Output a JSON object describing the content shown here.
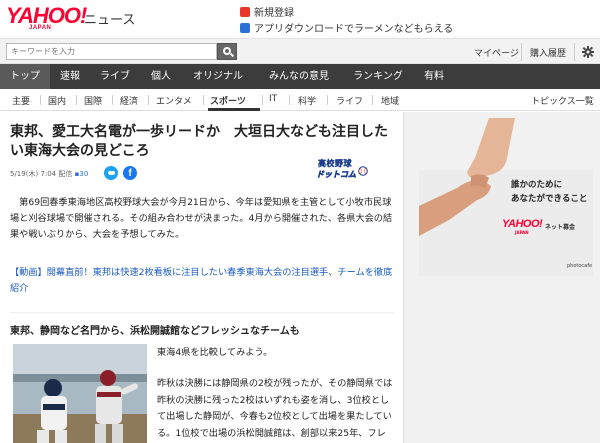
{
  "header": {
    "logo_text": "YAHOO!",
    "logo_sub": "JAPAN",
    "service_name": "ニュース",
    "promo_signup": "新規登録",
    "promo_app": "アプリダウンロードでラーメンなどもらえる"
  },
  "search": {
    "placeholder": "キーワードを入力"
  },
  "account": {
    "mypage": "マイページ",
    "premium": "購入履歴"
  },
  "main_nav": [
    {
      "label": "トップ",
      "active": true
    },
    {
      "label": "速報",
      "active": false
    },
    {
      "label": "ライブ",
      "active": false
    },
    {
      "label": "個人",
      "active": false
    },
    {
      "label": "オリジナル",
      "active": false
    },
    {
      "label": "みんなの意見",
      "active": false
    },
    {
      "label": "ランキング",
      "active": false
    },
    {
      "label": "有料",
      "active": false
    }
  ],
  "sub_nav": [
    {
      "label": "主要",
      "active": false
    },
    {
      "label": "国内",
      "active": false
    },
    {
      "label": "国際",
      "active": false
    },
    {
      "label": "経済",
      "active": false
    },
    {
      "label": "エンタメ",
      "active": false
    },
    {
      "label": "スポーツ",
      "active": true
    },
    {
      "label": "IT",
      "active": false
    },
    {
      "label": "科学",
      "active": false
    },
    {
      "label": "ライフ",
      "active": false
    },
    {
      "label": "地域",
      "active": false
    }
  ],
  "topics_link": "トピックス一覧",
  "article": {
    "title": "東邦、愛工大名電が一歩リードか　大垣日大なども注目したい東海大会の見どころ",
    "date": "5/19(木) 7:04",
    "delivery": "配信",
    "comment_count": "30",
    "media_line1": "高校野球",
    "media_line2": "ドットコム",
    "lead": "　第69回春季東海地区高校野球大会が今月21日から、今年は愛知県を主管として小牧市民球場と刈谷球場で開催される。その組み合わせが決まった。4月から開催された、各県大会の結果や戦いぶりから、大会を予想してみた。",
    "video_link": "【動画】開幕直前！東邦は快速2枚看板に注目したい春季東海大会の注目選手、チームを徹底紹介",
    "subheading": "東邦、静岡など名門から、浜松開誠館などフレッシュなチームも",
    "para1": "東海4県を比較してみよう。",
    "para2": "昨秋は決勝には静岡県の2校が残ったが、その静岡県では昨秋の決勝に残った2校はいずれも姿を消し、3位校として出場した静岡が、今春も2位校として出場を果たしている。1位校で出場の浜松開誠館は、創部以来25年、フレ"
  },
  "ad": {
    "copy_line1": "誰かのために",
    "copy_line2": "あなたができること",
    "logo_text": "YAHOO!",
    "logo_sub": "JAPAN",
    "fund_label": "ネット募金",
    "credit": "photocafe"
  },
  "colors": {
    "brand_red": "#ff0033",
    "nav_dark": "#3c3c3c",
    "link_blue": "#1a5bbf"
  }
}
